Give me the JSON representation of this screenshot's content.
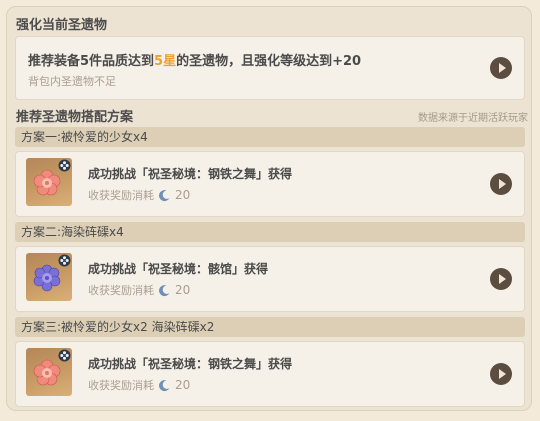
{
  "section1_title": "强化当前圣遗物",
  "recommend": {
    "text_prefix": "推荐装备5件品质达到",
    "text_highlight": "5星",
    "text_suffix": "的圣遗物，且强化等级达到+20",
    "subtext": "背包内圣遗物不足"
  },
  "section2_title": "推荐圣遗物搭配方案",
  "source_note": "数据来源于近期活跃玩家",
  "plans": [
    {
      "header": "方案一:被怜爱的少女x4",
      "title": "成功挑战「祝圣秘境：钢铁之舞」获得",
      "cost_label": "收获奖励消耗",
      "cost_value": "20",
      "icon": "pink-flower-artifact-icon"
    },
    {
      "header": "方案二:海染砗磲x4",
      "title": "成功挑战「祝圣秘境：骸馆」获得",
      "cost_label": "收获奖励消耗",
      "cost_value": "20",
      "icon": "purple-flower-artifact-icon"
    },
    {
      "header": "方案三:被怜爱的少女x2 海染砗磲x2",
      "title": "成功挑战「祝圣秘境：钢铁之舞」获得",
      "cost_label": "收获奖励消耗",
      "cost_value": "20",
      "icon": "pink-flower-artifact-icon"
    }
  ],
  "colors": {
    "highlight": "#f0a030",
    "button": "#5b4e41",
    "header_band": "#dccfb6"
  }
}
